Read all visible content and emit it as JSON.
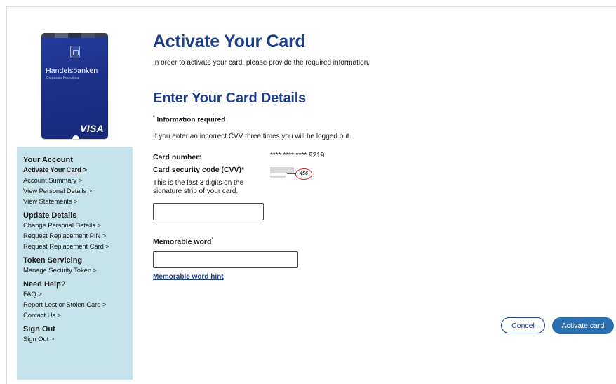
{
  "card": {
    "bank_name": "Handelsbanken",
    "sub_text": "Corporate Recruiting",
    "network": "VISA",
    "stripe_colors": [
      "#3a3f55",
      "#5b6378",
      "#2c3148",
      "#4a5066",
      "#3a3f55"
    ]
  },
  "sidebar": {
    "groups": [
      {
        "heading": "Your Account",
        "links": [
          "Activate Your Card >",
          "Account Summary >",
          "View Personal Details >",
          "View Statements >"
        ]
      },
      {
        "heading": "Update Details",
        "links": [
          "Change Personal Details >",
          "Request Replacement PIN >",
          "Request Replacement Card >"
        ]
      },
      {
        "heading": "Token Servicing",
        "links": [
          "Manage Security Token >"
        ]
      },
      {
        "heading": "Need Help?",
        "links": [
          "FAQ >",
          "Report Lost or Stolen Card >",
          "Contact Us >"
        ]
      },
      {
        "heading": "Sign Out",
        "links": [
          "Sign Out >"
        ]
      }
    ]
  },
  "main": {
    "title": "Activate Your Card",
    "intro": "In order to activate your card, please provide the required information.",
    "subtitle": "Enter Your Card Details",
    "required_mark": "*",
    "required_text": "Information required",
    "warning": "If you enter an incorrect CVV three times you will be logged out.",
    "card_number_label": "Card number:",
    "card_number_value": "**** **** **** 9219",
    "cvv_label": "Card security code (CVV)*",
    "cvv_hint": "This is the last 3 digits on the signature strip of your card.",
    "cvv_example": "456",
    "cvv_value": "",
    "memorable_label": "Memorable word",
    "memorable_mark": "*",
    "memorable_value": "",
    "memorable_hint_link": "Memorable word hint",
    "cancel_label": "Concel",
    "activate_label": "Activate card"
  },
  "colors": {
    "heading_blue": "#1d3f87",
    "button_blue": "#2a6fb0",
    "sidebar_bg": "#c6e3ec",
    "cvv_circle": "#cc2233"
  }
}
